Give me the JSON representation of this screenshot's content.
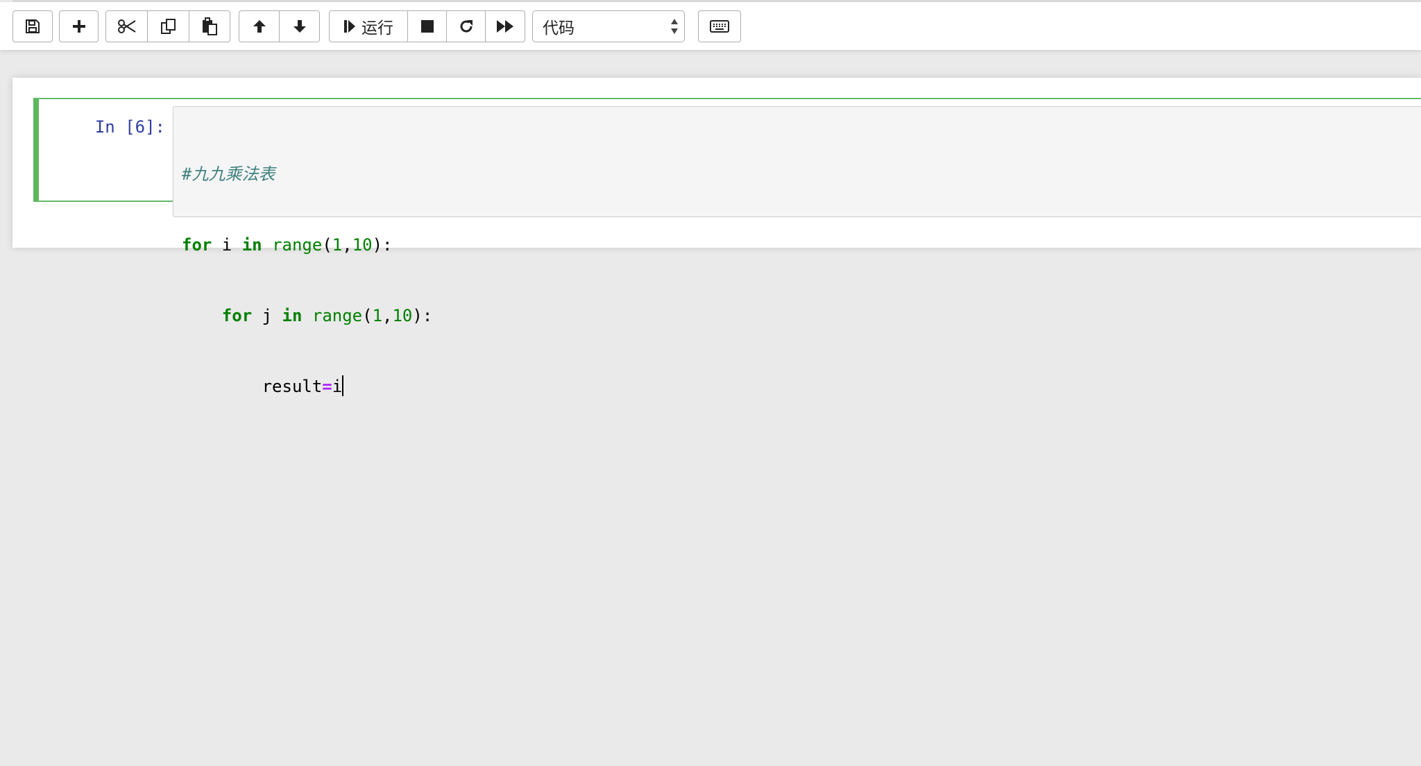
{
  "toolbar": {
    "run_label": "运行",
    "cell_type": "代码"
  },
  "cell": {
    "prompt": "In [6]:",
    "code": {
      "line1_comment": "#九九乘法表",
      "line2": {
        "kw_for": "for",
        "var": " i ",
        "kw_in": "in",
        "sp": " ",
        "builtin": "range",
        "open": "(",
        "n1": "1",
        "comma": ",",
        "n2": "10",
        "close": "):"
      },
      "line3": {
        "indent": "    ",
        "kw_for": "for",
        "var": " j ",
        "kw_in": "in",
        "sp": " ",
        "builtin": "range",
        "open": "(",
        "n1": "1",
        "comma": ",",
        "n2": "10",
        "close": "):"
      },
      "line4": {
        "indent": "        ",
        "lhs": "result",
        "op": "=",
        "rhs": "i"
      }
    }
  },
  "colors": {
    "selected_border": "#5cb85c",
    "prompt": "#303f9f",
    "comment": "#408080",
    "keyword": "#008000",
    "operator": "#aa22ff"
  }
}
